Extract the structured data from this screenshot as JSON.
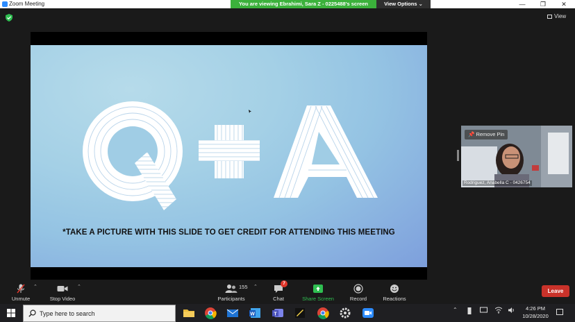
{
  "window": {
    "title": "Zoom Meeting",
    "banner": "You are viewing Ebrahimi, Sara Z - 0225488's screen",
    "view_options": "View Options ⌄",
    "controls": {
      "minimize": "—",
      "restore": "❐",
      "close": "✕"
    }
  },
  "meeting": {
    "view_label": "View",
    "slide": {
      "caption": "*TAKE A PICTURE WITH THIS SLIDE TO GET CREDIT FOR ATTENDING THIS MEETING",
      "heading_letters": [
        "Q",
        "+",
        "A"
      ]
    },
    "pinned": {
      "remove_pin": "Remove Pin",
      "participant_name": "Rodriguez, Anabella C - 0426754"
    }
  },
  "toolbar": {
    "unmute": "Unmute",
    "stop_video": "Stop Video",
    "participants": "Participants",
    "participants_count": "155",
    "chat": "Chat",
    "chat_badge": "7",
    "share_screen": "Share Screen",
    "record": "Record",
    "reactions": "Reactions",
    "leave": "Leave"
  },
  "taskbar": {
    "search_placeholder": "Type here to search",
    "time": "4:26 PM",
    "date": "10/28/2020",
    "apps": [
      "file-explorer",
      "chrome",
      "mail",
      "word",
      "teams",
      "sticky-notes",
      "chrome",
      "settings",
      "zoom"
    ]
  },
  "colors": {
    "banner_green": "#3bb13b",
    "share_green": "#2fbf51",
    "leave_red": "#c9322a",
    "badge_red": "#e0362b",
    "slide_blue": "#94c3e3"
  }
}
